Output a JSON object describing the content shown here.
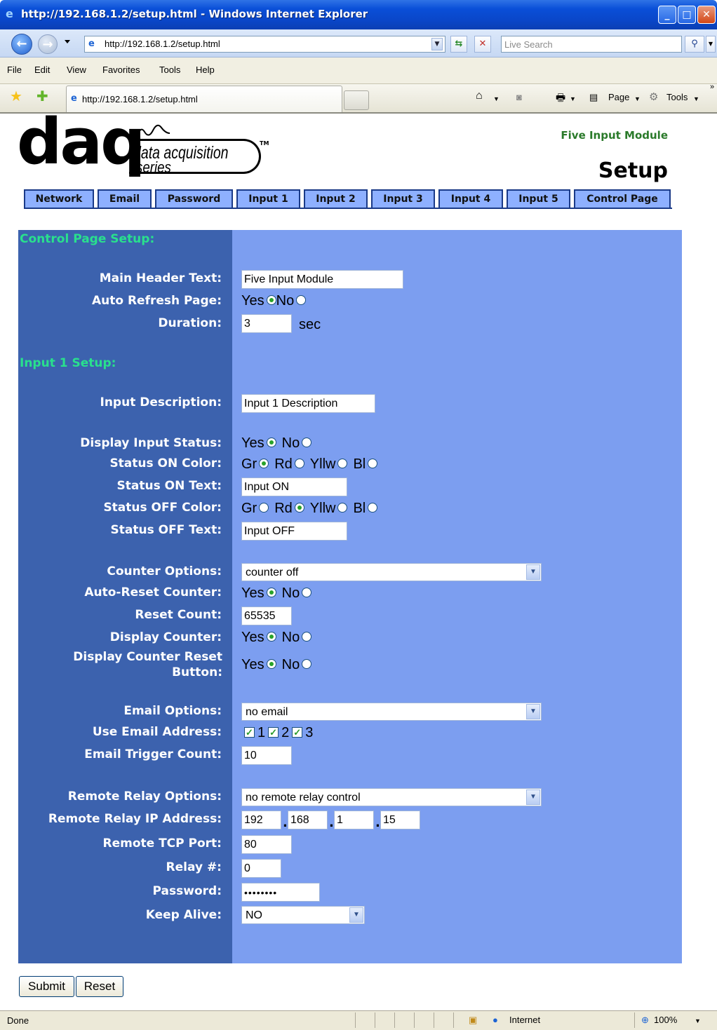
{
  "window": {
    "title": "http://192.168.1.2/setup.html - Windows Internet Explorer"
  },
  "addressbar": {
    "url": "http://192.168.1.2/setup.html",
    "search_placeholder": "Live Search"
  },
  "menu": [
    "File",
    "Edit",
    "View",
    "Favorites",
    "Tools",
    "Help"
  ],
  "tab": {
    "label": "http://192.168.1.2/setup.html"
  },
  "toolbar": {
    "page": "Page",
    "tools": "Tools"
  },
  "header": {
    "logo_main": "daq",
    "logo_sub1": "data acquisition",
    "logo_sub2": "series",
    "logo_tm": "TM",
    "module": "Five Input Module",
    "page_title": "Setup"
  },
  "nav_tabs": [
    "Network",
    "Email",
    "Password",
    "Input 1",
    "Input 2",
    "Input 3",
    "Input 4",
    "Input 5",
    "Control Page"
  ],
  "control": {
    "section": "Control Page Setup:",
    "main_header_label": "Main Header Text:",
    "main_header_value": "Five Input Module",
    "auto_refresh_label": "Auto Refresh Page:",
    "yes": "Yes",
    "no": "No",
    "auto_refresh_selected": "Yes",
    "duration_label": "Duration:",
    "duration_value": "3",
    "duration_unit": "sec"
  },
  "input": {
    "section": "Input 1 Setup:",
    "description_label": "Input Description:",
    "description_value": "Input 1 Description",
    "display_status_label": "Display Input Status:",
    "display_status_selected": "Yes",
    "on_color_label": "Status ON Color:",
    "on_color_selected": "Gr",
    "colors": [
      "Gr",
      "Rd",
      "Yllw",
      "Bl"
    ],
    "on_text_label": "Status ON Text:",
    "on_text_value": "Input ON",
    "off_color_label": "Status OFF Color:",
    "off_color_selected": "Rd",
    "off_text_label": "Status OFF Text:",
    "off_text_value": "Input OFF",
    "counter_options_label": "Counter Options:",
    "counter_options_value": "counter off",
    "auto_reset_label": "Auto-Reset Counter:",
    "auto_reset_selected": "Yes",
    "reset_count_label": "Reset Count:",
    "reset_count_value": "65535",
    "display_counter_label": "Display Counter:",
    "display_counter_selected": "Yes",
    "display_reset_label": "Display Counter Reset Button:",
    "display_reset_selected": "Yes",
    "email_options_label": "Email Options:",
    "email_options_value": "no email",
    "use_email_label": "Use Email Address:",
    "email_addresses": [
      "1",
      "2",
      "3"
    ],
    "email_trigger_label": "Email Trigger Count:",
    "email_trigger_value": "10",
    "relay_options_label": "Remote Relay Options:",
    "relay_options_value": "no remote relay control",
    "relay_ip_label": "Remote Relay IP Address:",
    "relay_ip": [
      "192",
      "168",
      "1",
      "15"
    ],
    "tcp_port_label": "Remote TCP Port:",
    "tcp_port_value": "80",
    "relay_num_label": "Relay #:",
    "relay_num_value": "0",
    "password_label": "Password:",
    "password_value": "••••••••",
    "keep_alive_label": "Keep Alive:",
    "keep_alive_value": "NO"
  },
  "buttons": {
    "submit": "Submit",
    "reset": "Reset"
  },
  "status": {
    "text": "Done",
    "zone": "Internet",
    "zoom": "100%"
  },
  "colors": {
    "label_col": "#3c62ae",
    "panel": "#7c9ef0",
    "section": "#29e08d",
    "module": "#2a7a2a"
  }
}
